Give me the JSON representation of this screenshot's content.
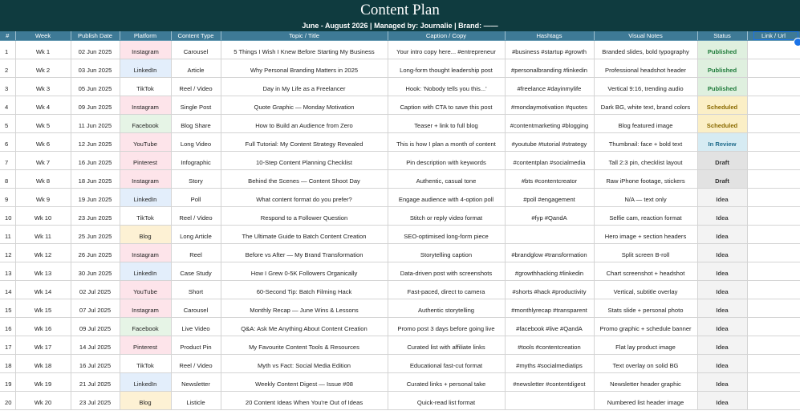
{
  "title": "Content Plan",
  "subtitle": "June - August 2026 | Managed by: Journalie | Brand: ——",
  "columns": [
    "#",
    "Week",
    "Publish Date",
    "Platform",
    "Content Type",
    "Topic / Title",
    "Caption / Copy",
    "Hashtags",
    "Visual Notes",
    "Status",
    "Link / Url"
  ],
  "colors": {
    "header_dark": "#0f3b3f",
    "header_row": "#3e7a96",
    "platform": {
      "Instagram": "#fde4ea",
      "LinkedIn": "#e3eefb",
      "TikTok": "#ffffff",
      "Facebook": "#e6f4e6",
      "YouTube": "#fde4ea",
      "Pinterest": "#fde4ea",
      "Blog": "#fdf1d4"
    },
    "status": {
      "Published": {
        "bg": "#dff0df",
        "fg": "#1e7a3a"
      },
      "Scheduled": {
        "bg": "#fbefc6",
        "fg": "#8a6a00"
      },
      "In Review": {
        "bg": "#d6ebf3",
        "fg": "#1e6a8a"
      },
      "Draft": {
        "bg": "#e2e2e2",
        "fg": "#333333"
      },
      "Idea": {
        "bg": "#f3f3f3",
        "fg": "#444444"
      }
    }
  },
  "rows": [
    {
      "n": "1",
      "week": "Wk 1",
      "date": "02 Jun 2025",
      "platform": "Instagram",
      "type": "Carousel",
      "topic": "5 Things I Wish I Knew Before Starting My Business",
      "caption": "Your intro copy here... #entrepreneur",
      "hashtags": "#business #startup #growth",
      "visual": "Branded slides, bold typography",
      "status": "Published",
      "link": ""
    },
    {
      "n": "2",
      "week": "Wk 2",
      "date": "03 Jun 2025",
      "platform": "LinkedIn",
      "type": "Article",
      "topic": "Why Personal Branding Matters in 2025",
      "caption": "Long-form thought leadership post",
      "hashtags": "#personalbranding #linkedin",
      "visual": "Professional headshot header",
      "status": "Published",
      "link": ""
    },
    {
      "n": "3",
      "week": "Wk 3",
      "date": "05 Jun 2025",
      "platform": "TikTok",
      "type": "Reel / Video",
      "topic": "Day in My Life as a Freelancer",
      "caption": "Hook: 'Nobody tells you this...'",
      "hashtags": "#freelance #dayinmylife",
      "visual": "Vertical 9:16, trending audio",
      "status": "Published",
      "link": ""
    },
    {
      "n": "4",
      "week": "Wk 4",
      "date": "09 Jun 2025",
      "platform": "Instagram",
      "type": "Single Post",
      "topic": "Quote Graphic — Monday Motivation",
      "caption": "Caption with CTA to save this post",
      "hashtags": "#mondaymotivation #quotes",
      "visual": "Dark BG, white text, brand colors",
      "status": "Scheduled",
      "link": ""
    },
    {
      "n": "5",
      "week": "Wk 5",
      "date": "11 Jun 2025",
      "platform": "Facebook",
      "type": "Blog Share",
      "topic": "How to Build an Audience from Zero",
      "caption": "Teaser + link to full blog",
      "hashtags": "#contentmarketing #blogging",
      "visual": "Blog featured image",
      "status": "Scheduled",
      "link": ""
    },
    {
      "n": "6",
      "week": "Wk 6",
      "date": "12 Jun 2025",
      "platform": "YouTube",
      "type": "Long Video",
      "topic": "Full Tutorial: My Content Strategy Revealed",
      "caption": "This is how I plan a month of content",
      "hashtags": "#youtube #tutorial #strategy",
      "visual": "Thumbnail: face + bold text",
      "status": "In Review",
      "link": ""
    },
    {
      "n": "7",
      "week": "Wk 7",
      "date": "16 Jun 2025",
      "platform": "Pinterest",
      "type": "Infographic",
      "topic": "10-Step Content Planning Checklist",
      "caption": "Pin description with keywords",
      "hashtags": "#contentplan #socialmedia",
      "visual": "Tall 2:3 pin, checklist layout",
      "status": "Draft",
      "link": ""
    },
    {
      "n": "8",
      "week": "Wk 8",
      "date": "18 Jun 2025",
      "platform": "Instagram",
      "type": "Story",
      "topic": "Behind the Scenes — Content Shoot Day",
      "caption": "Authentic, casual tone",
      "hashtags": "#bts #contentcreator",
      "visual": "Raw iPhone footage, stickers",
      "status": "Draft",
      "link": ""
    },
    {
      "n": "9",
      "week": "Wk 9",
      "date": "19 Jun 2025",
      "platform": "LinkedIn",
      "type": "Poll",
      "topic": "What content format do you prefer?",
      "caption": "Engage audience with 4-option poll",
      "hashtags": "#poll #engagement",
      "visual": "N/A — text only",
      "status": "Idea",
      "link": ""
    },
    {
      "n": "10",
      "week": "Wk 10",
      "date": "23 Jun 2025",
      "platform": "TikTok",
      "type": "Reel / Video",
      "topic": "Respond to a Follower Question",
      "caption": "Stitch or reply video format",
      "hashtags": "#fyp #QandA",
      "visual": "Selfie cam, reaction format",
      "status": "Idea",
      "link": ""
    },
    {
      "n": "11",
      "week": "Wk 11",
      "date": "25 Jun 2025",
      "platform": "Blog",
      "type": "Long Article",
      "topic": "The Ultimate Guide to Batch Content Creation",
      "caption": "SEO-optimised long-form piece",
      "hashtags": "",
      "visual": "Hero image + section headers",
      "status": "Idea",
      "link": ""
    },
    {
      "n": "12",
      "week": "Wk 12",
      "date": "26 Jun 2025",
      "platform": "Instagram",
      "type": "Reel",
      "topic": "Before vs After — My Brand Transformation",
      "caption": "Storytelling caption",
      "hashtags": "#brandglow #transformation",
      "visual": "Split screen B-roll",
      "status": "Idea",
      "link": ""
    },
    {
      "n": "13",
      "week": "Wk 13",
      "date": "30 Jun 2025",
      "platform": "LinkedIn",
      "type": "Case Study",
      "topic": "How I Grew 0-5K Followers Organically",
      "caption": "Data-driven post with screenshots",
      "hashtags": "#growthhacking #linkedin",
      "visual": "Chart screenshot + headshot",
      "status": "Idea",
      "link": ""
    },
    {
      "n": "14",
      "week": "Wk 14",
      "date": "02 Jul 2025",
      "platform": "YouTube",
      "type": "Short",
      "topic": "60-Second Tip: Batch Filming Hack",
      "caption": "Fast-paced, direct to camera",
      "hashtags": "#shorts #hack #productivity",
      "visual": "Vertical, subtitle overlay",
      "status": "Idea",
      "link": ""
    },
    {
      "n": "15",
      "week": "Wk 15",
      "date": "07 Jul 2025",
      "platform": "Instagram",
      "type": "Carousel",
      "topic": "Monthly Recap — June Wins & Lessons",
      "caption": "Authentic storytelling",
      "hashtags": "#monthlyrecap #transparent",
      "visual": "Stats slide + personal photo",
      "status": "Idea",
      "link": ""
    },
    {
      "n": "16",
      "week": "Wk 16",
      "date": "09 Jul 2025",
      "platform": "Facebook",
      "type": "Live Video",
      "topic": "Q&A: Ask Me Anything About Content Creation",
      "caption": "Promo post 3 days before going live",
      "hashtags": "#facebook #live #QandA",
      "visual": "Promo graphic + schedule banner",
      "status": "Idea",
      "link": ""
    },
    {
      "n": "17",
      "week": "Wk 17",
      "date": "14 Jul 2025",
      "platform": "Pinterest",
      "type": "Product Pin",
      "topic": "My Favourite Content Tools & Resources",
      "caption": "Curated list with affiliate links",
      "hashtags": "#tools #contentcreation",
      "visual": "Flat lay product image",
      "status": "Idea",
      "link": ""
    },
    {
      "n": "18",
      "week": "Wk 18",
      "date": "16 Jul 2025",
      "platform": "TikTok",
      "type": "Reel / Video",
      "topic": "Myth vs Fact: Social Media Edition",
      "caption": "Educational fast-cut format",
      "hashtags": "#myths #socialmediatips",
      "visual": "Text overlay on solid BG",
      "status": "Idea",
      "link": ""
    },
    {
      "n": "19",
      "week": "Wk 19",
      "date": "21 Jul 2025",
      "platform": "LinkedIn",
      "type": "Newsletter",
      "topic": "Weekly Content Digest — Issue #08",
      "caption": "Curated links + personal take",
      "hashtags": "#newsletter #contentdigest",
      "visual": "Newsletter header graphic",
      "status": "Idea",
      "link": ""
    },
    {
      "n": "20",
      "week": "Wk 20",
      "date": "23 Jul 2025",
      "platform": "Blog",
      "type": "Listicle",
      "topic": "20 Content Ideas When You're Out of Ideas",
      "caption": "Quick-read list format",
      "hashtags": "",
      "visual": "Numbered list header image",
      "status": "Idea",
      "link": ""
    }
  ]
}
